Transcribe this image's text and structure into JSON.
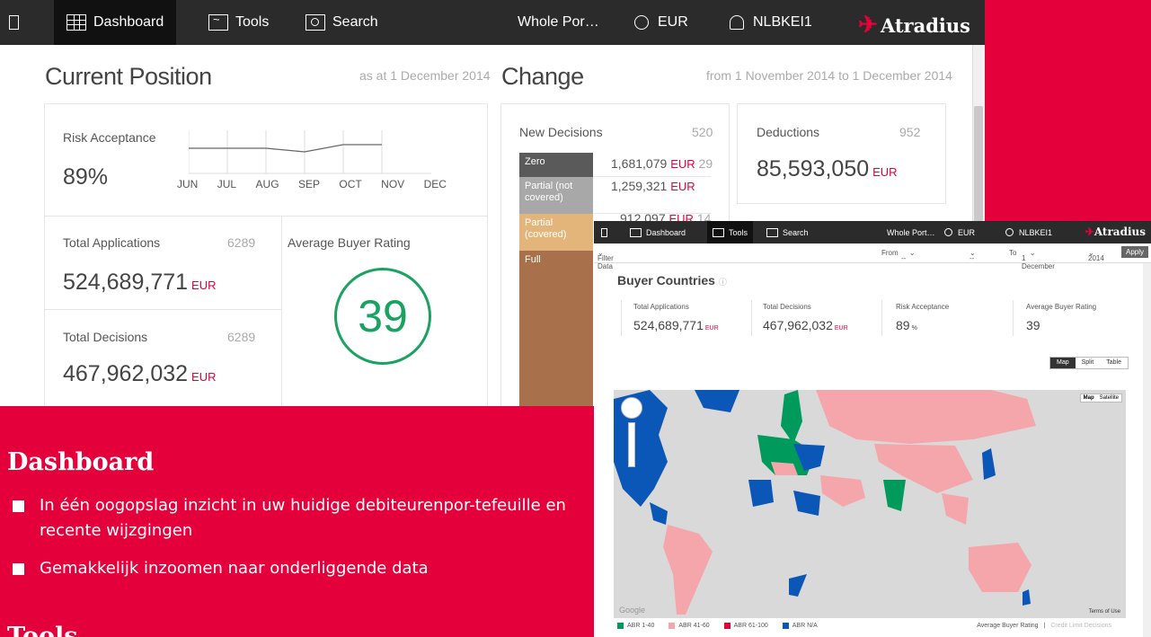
{
  "dashboard": {
    "nav": {
      "dashboard": "Dashboard",
      "tools": "Tools",
      "search": "Search",
      "portfolio": "Whole Por…",
      "currency": "EUR",
      "user": "NLBKEI1",
      "brand": "Atradius"
    },
    "current_position": {
      "title": "Current Position",
      "as_at": "as at 1 December 2014",
      "risk_acceptance_label": "Risk Acceptance",
      "risk_acceptance_value": "89%",
      "risk_acceptance_trend": [
        0.89,
        0.89,
        0.89,
        0.88,
        0.9,
        0.9
      ],
      "months": [
        "JUN",
        "JUL",
        "AUG",
        "SEP",
        "OCT",
        "NOV",
        "DEC"
      ],
      "total_applications_label": "Total Applications",
      "total_applications_count": "6289",
      "total_applications_value": "524,689,771",
      "total_decisions_label": "Total Decisions",
      "total_decisions_count": "6289",
      "total_decisions_value": "467,962,032",
      "unit": "EUR",
      "avg_buyer_rating_label": "Average Buyer Rating",
      "avg_buyer_rating_value": "39"
    },
    "change": {
      "title": "Change",
      "period": "from 1 November 2014 to 1 December 2014",
      "new_decisions_label": "New Decisions",
      "new_decisions_count": "520",
      "segments": [
        {
          "label": "Zero",
          "color": "#5a5a5a"
        },
        {
          "label": "Partial (not covered)",
          "color": "#a8a8a8"
        },
        {
          "label": "Partial (covered)",
          "color": "#e3b57a"
        },
        {
          "label": "Full",
          "color": "#a8714b"
        }
      ],
      "rows": [
        {
          "amount": "1,681,079",
          "unit": "EUR",
          "count": "29"
        },
        {
          "amount": "1,259,321",
          "unit": "EUR",
          "count": ""
        },
        {
          "amount": "912,097",
          "unit": "EUR",
          "count": "14"
        }
      ],
      "deductions_label": "Deductions",
      "deductions_count": "952",
      "deductions_value": "85,593,050",
      "unit": "EUR"
    }
  },
  "buyer_countries": {
    "nav": {
      "dashboard": "Dashboard",
      "tools": "Tools",
      "search": "Search",
      "portfolio": "Whole Port…",
      "currency": "EUR",
      "user": "NLBKEI1",
      "brand": "Atradius"
    },
    "filter": {
      "filter_data": "Filter Data",
      "from_label": "From",
      "from_value1": "--",
      "from_value2": "--",
      "to_label": "To",
      "to_value": "1 December",
      "year": "2014",
      "apply": "Apply"
    },
    "title": "Buyer Countries",
    "kpis": [
      {
        "label": "Total Applications",
        "value": "524,689,771",
        "unit": "EUR"
      },
      {
        "label": "Total Decisions",
        "value": "467,962,032",
        "unit": "EUR"
      },
      {
        "label": "Risk Acceptance",
        "value": "89",
        "unit": "%"
      },
      {
        "label": "Average Buyer Rating",
        "value": "39",
        "unit": ""
      }
    ],
    "view_toggle": [
      "Map",
      "Split",
      "Table"
    ],
    "map_toggle": [
      "Map",
      "Satellite"
    ],
    "map_footer": {
      "google": "Google",
      "terms": "Terms of Use"
    },
    "legend": [
      {
        "label": "ABR 1-40",
        "color": "#009a5c"
      },
      {
        "label": "ABR 41-60",
        "color": "#f4a6aa"
      },
      {
        "label": "ABR 61-100",
        "color": "#e4003a"
      },
      {
        "label": "ABR N/A",
        "color": "#0b57b8"
      }
    ],
    "legend_right": {
      "active": "Average Buyer Rating",
      "separator": "|",
      "inactive": "Credit Limit Decisions"
    }
  },
  "copy": {
    "dashboard_heading": "Dashboard",
    "bullet1": "In één oogopslag inzicht in uw huidige debiteurenpor-tefeuille en recente wijzgingen",
    "bullet2": "Gemakkelijk inzoomen naar onderliggende data",
    "tools_heading": "Tools"
  }
}
